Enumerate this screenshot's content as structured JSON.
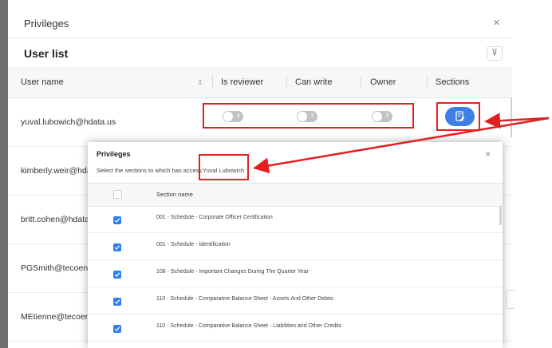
{
  "dialog": {
    "title": "Privileges",
    "close_glyph": "×",
    "list_title": "User list",
    "filter_glyph": "⊽"
  },
  "table": {
    "columns": [
      "User name",
      "Is reviewer",
      "Can write",
      "Owner",
      "Sections"
    ],
    "sort_glyph": "⇕",
    "rows": [
      {
        "email": "yuval.lubowich@hdata.us"
      },
      {
        "email": "kimberly.weir@hdata.us"
      },
      {
        "email": "britt.cohen@hdata.us"
      },
      {
        "email": "PGSmith@tecoenergy.com"
      },
      {
        "email": "MEtienne@tecoenergy.com"
      }
    ],
    "first_row_toggles": [
      {
        "name": "is-reviewer",
        "on": false,
        "glyph": "X"
      },
      {
        "name": "can-write",
        "on": false,
        "glyph": "X"
      },
      {
        "name": "owner",
        "on": false,
        "glyph": "X"
      }
    ]
  },
  "popup": {
    "title": "Privileges",
    "close_glyph": "×",
    "description": "Select the sections to which has access",
    "user_name": "Yuval Lubowich",
    "column": "Section name",
    "sections": [
      {
        "label": "001 - Schedule - Corporate Officer Certification",
        "checked": true
      },
      {
        "label": "001 - Schedule - Identification",
        "checked": true
      },
      {
        "label": "108 - Schedule - Important Changes During The Quarter Year",
        "checked": true
      },
      {
        "label": "110 - Schedule - Comparative Balance Sheet - Assets And Other Debits",
        "checked": true
      },
      {
        "label": "110 - Schedule - Comparative Balance Sheet - Liabilities and Other Credits",
        "checked": true
      }
    ]
  },
  "colors": {
    "accent": "#3d7fe6",
    "highlight": "#e32020",
    "checkbox": "#2f80ed",
    "toggle_off": "#c2c2c2"
  },
  "icons": {
    "close": "close-icon",
    "filter": "filter-icon",
    "sort": "sort-icon",
    "sections": "document-edit-icon",
    "check": "check-icon"
  }
}
